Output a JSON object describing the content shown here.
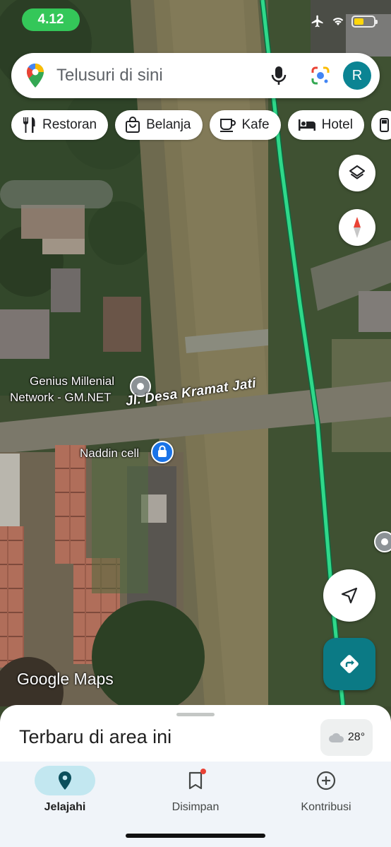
{
  "status_bar": {
    "time": "4.12"
  },
  "search": {
    "placeholder": "Telusuri di sini",
    "avatar_letter": "R"
  },
  "chips": [
    {
      "label": "Restoran",
      "icon": "fork-knife-icon"
    },
    {
      "label": "Belanja",
      "icon": "shopping-bag-icon"
    },
    {
      "label": "Kafe",
      "icon": "coffee-cup-icon"
    },
    {
      "label": "Hotel",
      "icon": "bed-icon"
    }
  ],
  "map": {
    "places": [
      {
        "name_line1": "Genius Millenial",
        "name_line2": "Network - GM.NET"
      },
      {
        "name": "Naddin cell"
      }
    ],
    "road": "Jl. Desa Kramat Jati",
    "attribution": "Google Maps",
    "route_color": "#2fd88a"
  },
  "sheet": {
    "title": "Terbaru di area ini",
    "temperature": "28°"
  },
  "nav": {
    "items": [
      {
        "label": "Jelajahi",
        "active": true
      },
      {
        "label": "Disimpan",
        "active": false
      },
      {
        "label": "Kontribusi",
        "active": false
      }
    ]
  },
  "colors": {
    "accent": "#0b7a85",
    "active_nav": "#c2e7f0",
    "status_green": "#34c759"
  }
}
